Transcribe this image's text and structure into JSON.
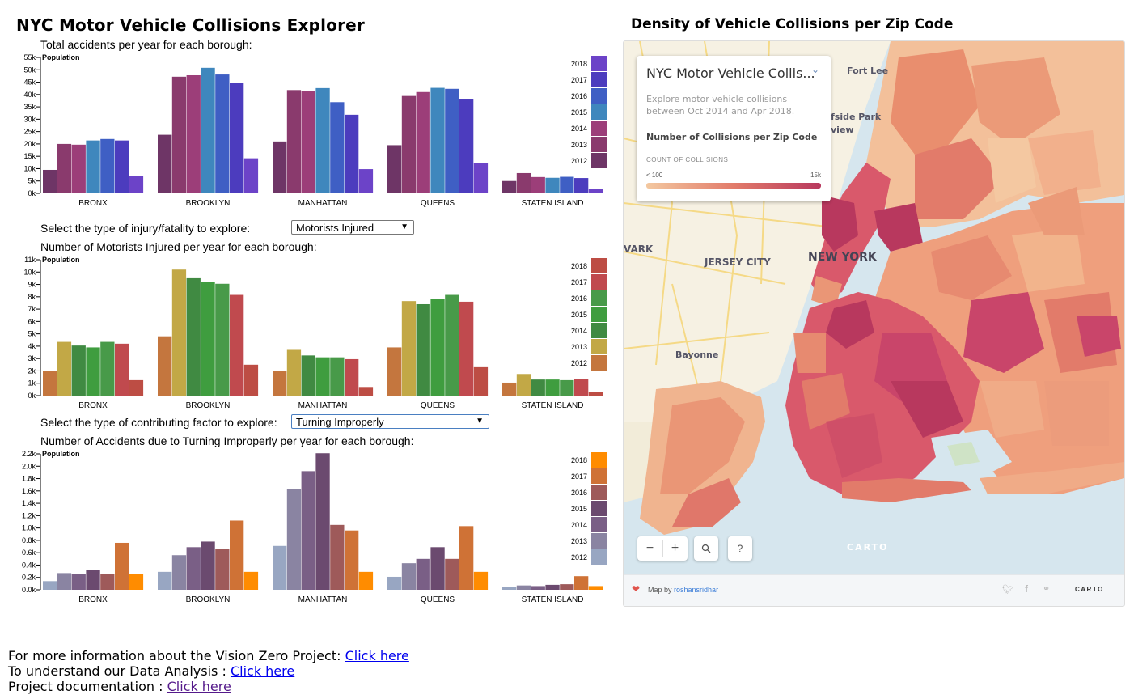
{
  "page": {
    "title": "NYC Motor Vehicle Collisions Explorer",
    "map_title": "Density of Vehicle Collisions per Zip Code"
  },
  "charts_text": {
    "chart1_caption": "Total accidents per year for each borough:",
    "injury_prompt": "Select the type of injury/fatality to explore:",
    "injury_select": "Motorists Injured",
    "chart2_caption": "Number of Motorists Injured per year for each borough:",
    "factor_prompt": "Select the type of contributing factor to explore:",
    "factor_select": "Turning Improperly",
    "chart3_caption": "Number of Accidents due to Turning Improperly per year for each borough:"
  },
  "chart_data": [
    {
      "type": "bar",
      "title": "Total accidents per year for each borough:",
      "categories": [
        "BRONX",
        "BROOKLYN",
        "MANHATTAN",
        "QUEENS",
        "STATEN ISLAND"
      ],
      "years": [
        "2012",
        "2013",
        "2014",
        "2015",
        "2016",
        "2017",
        "2018"
      ],
      "colors": [
        "#6e3566",
        "#8a3a6d",
        "#9c3e79",
        "#3f87bd",
        "#3f5fc4",
        "#4c3cbe",
        "#6c43c8"
      ],
      "ylabel": "Population",
      "ylim": [
        0,
        55000
      ],
      "yticks": [
        "0k",
        "5k",
        "10k",
        "15k",
        "20k",
        "25k",
        "30k",
        "35k",
        "40k",
        "45k",
        "50k",
        "55k"
      ],
      "values": [
        [
          9500,
          20000,
          19700,
          21400,
          22000,
          21400,
          7000
        ],
        [
          23700,
          47200,
          47800,
          50800,
          48100,
          44800,
          14200
        ],
        [
          21000,
          41800,
          41500,
          42600,
          36900,
          31800,
          9800
        ],
        [
          19500,
          39400,
          41000,
          42700,
          42300,
          38300,
          12300
        ],
        [
          5000,
          8200,
          6600,
          6300,
          6700,
          6200,
          1900
        ]
      ]
    },
    {
      "type": "bar",
      "title": "Number of Motorists Injured per year for each borough:",
      "categories": [
        "BRONX",
        "BROOKLYN",
        "MANHATTAN",
        "QUEENS",
        "STATEN ISLAND"
      ],
      "years": [
        "2012",
        "2013",
        "2014",
        "2015",
        "2016",
        "2017",
        "2018"
      ],
      "colors": [
        "#c4763e",
        "#c2a846",
        "#408a42",
        "#3f9d3f",
        "#489a49",
        "#c04a4e",
        "#bd4d44"
      ],
      "ylabel": "Population",
      "ylim": [
        0,
        11000
      ],
      "yticks": [
        "0k",
        "1k",
        "2k",
        "3k",
        "4k",
        "5k",
        "6k",
        "7k",
        "8k",
        "9k",
        "10k",
        "11k"
      ],
      "values": [
        [
          2000,
          4350,
          4050,
          3900,
          4350,
          4200,
          1250
        ],
        [
          4800,
          10200,
          9500,
          9200,
          9050,
          8150,
          2500
        ],
        [
          2000,
          3700,
          3250,
          3100,
          3100,
          2950,
          700
        ],
        [
          3900,
          7650,
          7400,
          7800,
          8150,
          7600,
          2300
        ],
        [
          1050,
          1750,
          1300,
          1300,
          1250,
          1350,
          300
        ]
      ]
    },
    {
      "type": "bar",
      "title": "Number of Accidents due to Turning Improperly per year for each borough:",
      "categories": [
        "BRONX",
        "BROOKLYN",
        "MANHATTAN",
        "QUEENS",
        "STATEN ISLAND"
      ],
      "years": [
        "2012",
        "2013",
        "2014",
        "2015",
        "2016",
        "2017",
        "2018"
      ],
      "colors": [
        "#98a6c2",
        "#8a84a2",
        "#7a5f86",
        "#6b4a6f",
        "#9e5a5a",
        "#cf7236",
        "#ff8c00"
      ],
      "ylabel": "Population",
      "ylim": [
        0,
        2200
      ],
      "yticks": [
        "0.0k",
        "0.2k",
        "0.4k",
        "0.6k",
        "0.8k",
        "1.0k",
        "1.2k",
        "1.4k",
        "1.6k",
        "1.8k",
        "2.0k",
        "2.2k"
      ],
      "values": [
        [
          140,
          270,
          260,
          320,
          260,
          760,
          250
        ],
        [
          290,
          560,
          690,
          780,
          660,
          1120,
          290
        ],
        [
          710,
          1630,
          1920,
          2210,
          1050,
          960,
          290
        ],
        [
          210,
          430,
          500,
          690,
          500,
          1030,
          290
        ],
        [
          40,
          70,
          60,
          80,
          90,
          220,
          60
        ]
      ]
    }
  ],
  "map": {
    "legend_title": "NYC Motor Vehicle Collis...",
    "legend_desc": "Explore motor vehicle collisions between Oct 2014 and Apr 2018.",
    "legend_metric": "Number of Collisions per Zip Code",
    "legend_scale_title": "COUNT OF COLLISIONS",
    "legend_min": "< 100",
    "legend_max": "15k",
    "labels": {
      "fort_lee": "Fort Lee",
      "side_park": "fside Park",
      "view": "view",
      "newark": "VARK",
      "jersey_city": "JERSEY CITY",
      "new_york": "NEW YORK",
      "bayonne": "Bayonne",
      "carto_watermark": "CARTO"
    },
    "zoom_out": "−",
    "zoom_in": "+",
    "search_icon": "magnifier",
    "help": "?",
    "credit_prefix": "Map by",
    "credit_user": "roshansridhar",
    "carto_logo": "CARTO",
    "colors": {
      "low": "#f3c8a0",
      "mid": "#e27b6a",
      "high": "#b8385e",
      "water": "#d6e6ee",
      "land": "#f6f1e3"
    }
  },
  "footer": {
    "line1": "For more information about the Vision Zero Project:",
    "line2": "To understand our Data Analysis :",
    "line3": "Project documentation :",
    "link": "Click here"
  }
}
